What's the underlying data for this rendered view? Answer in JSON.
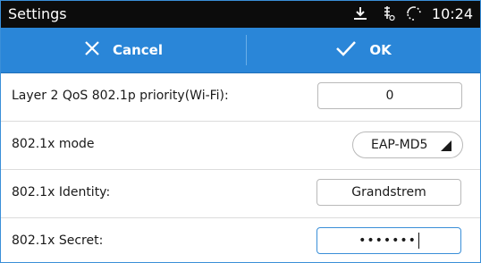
{
  "statusbar": {
    "title": "Settings",
    "time": "10:24",
    "icons": [
      "download-icon",
      "signal-icon",
      "sync-icon"
    ]
  },
  "actionbar": {
    "cancel_label": "Cancel",
    "ok_label": "OK",
    "bg_color": "#2a86d8"
  },
  "rows": [
    {
      "label": "Layer 2 QoS 802.1p priority(Wi-Fi):",
      "value": "0"
    },
    {
      "label": "802.1x mode",
      "value": "EAP-MD5"
    },
    {
      "label": "802.1x Identity:",
      "value": "Grandstrem"
    },
    {
      "label": "802.1x Secret:",
      "value": "•••••••"
    }
  ]
}
